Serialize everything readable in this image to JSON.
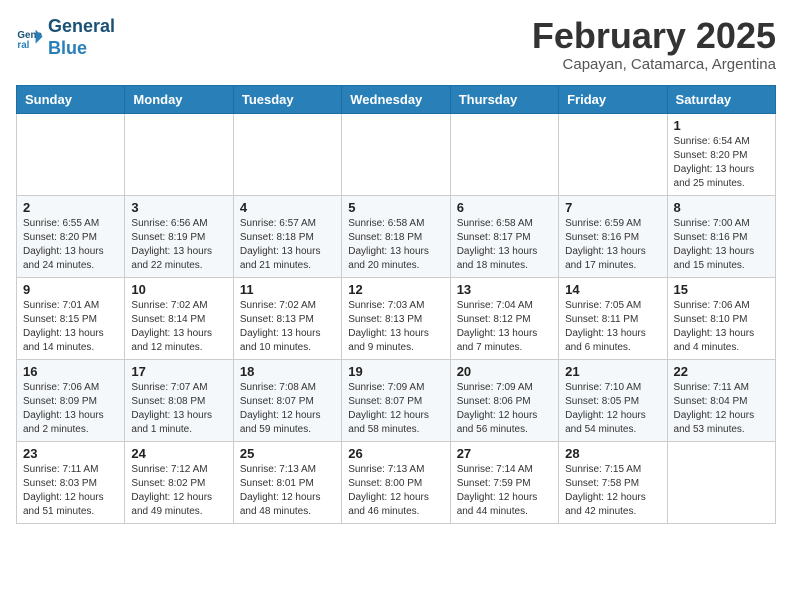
{
  "header": {
    "logo_line1": "General",
    "logo_line2": "Blue",
    "month": "February 2025",
    "location": "Capayan, Catamarca, Argentina"
  },
  "days_of_week": [
    "Sunday",
    "Monday",
    "Tuesday",
    "Wednesday",
    "Thursday",
    "Friday",
    "Saturday"
  ],
  "weeks": [
    [
      {
        "day": "",
        "info": ""
      },
      {
        "day": "",
        "info": ""
      },
      {
        "day": "",
        "info": ""
      },
      {
        "day": "",
        "info": ""
      },
      {
        "day": "",
        "info": ""
      },
      {
        "day": "",
        "info": ""
      },
      {
        "day": "1",
        "info": "Sunrise: 6:54 AM\nSunset: 8:20 PM\nDaylight: 13 hours\nand 25 minutes."
      }
    ],
    [
      {
        "day": "2",
        "info": "Sunrise: 6:55 AM\nSunset: 8:20 PM\nDaylight: 13 hours\nand 24 minutes."
      },
      {
        "day": "3",
        "info": "Sunrise: 6:56 AM\nSunset: 8:19 PM\nDaylight: 13 hours\nand 22 minutes."
      },
      {
        "day": "4",
        "info": "Sunrise: 6:57 AM\nSunset: 8:18 PM\nDaylight: 13 hours\nand 21 minutes."
      },
      {
        "day": "5",
        "info": "Sunrise: 6:58 AM\nSunset: 8:18 PM\nDaylight: 13 hours\nand 20 minutes."
      },
      {
        "day": "6",
        "info": "Sunrise: 6:58 AM\nSunset: 8:17 PM\nDaylight: 13 hours\nand 18 minutes."
      },
      {
        "day": "7",
        "info": "Sunrise: 6:59 AM\nSunset: 8:16 PM\nDaylight: 13 hours\nand 17 minutes."
      },
      {
        "day": "8",
        "info": "Sunrise: 7:00 AM\nSunset: 8:16 PM\nDaylight: 13 hours\nand 15 minutes."
      }
    ],
    [
      {
        "day": "9",
        "info": "Sunrise: 7:01 AM\nSunset: 8:15 PM\nDaylight: 13 hours\nand 14 minutes."
      },
      {
        "day": "10",
        "info": "Sunrise: 7:02 AM\nSunset: 8:14 PM\nDaylight: 13 hours\nand 12 minutes."
      },
      {
        "day": "11",
        "info": "Sunrise: 7:02 AM\nSunset: 8:13 PM\nDaylight: 13 hours\nand 10 minutes."
      },
      {
        "day": "12",
        "info": "Sunrise: 7:03 AM\nSunset: 8:13 PM\nDaylight: 13 hours\nand 9 minutes."
      },
      {
        "day": "13",
        "info": "Sunrise: 7:04 AM\nSunset: 8:12 PM\nDaylight: 13 hours\nand 7 minutes."
      },
      {
        "day": "14",
        "info": "Sunrise: 7:05 AM\nSunset: 8:11 PM\nDaylight: 13 hours\nand 6 minutes."
      },
      {
        "day": "15",
        "info": "Sunrise: 7:06 AM\nSunset: 8:10 PM\nDaylight: 13 hours\nand 4 minutes."
      }
    ],
    [
      {
        "day": "16",
        "info": "Sunrise: 7:06 AM\nSunset: 8:09 PM\nDaylight: 13 hours\nand 2 minutes."
      },
      {
        "day": "17",
        "info": "Sunrise: 7:07 AM\nSunset: 8:08 PM\nDaylight: 13 hours\nand 1 minute."
      },
      {
        "day": "18",
        "info": "Sunrise: 7:08 AM\nSunset: 8:07 PM\nDaylight: 12 hours\nand 59 minutes."
      },
      {
        "day": "19",
        "info": "Sunrise: 7:09 AM\nSunset: 8:07 PM\nDaylight: 12 hours\nand 58 minutes."
      },
      {
        "day": "20",
        "info": "Sunrise: 7:09 AM\nSunset: 8:06 PM\nDaylight: 12 hours\nand 56 minutes."
      },
      {
        "day": "21",
        "info": "Sunrise: 7:10 AM\nSunset: 8:05 PM\nDaylight: 12 hours\nand 54 minutes."
      },
      {
        "day": "22",
        "info": "Sunrise: 7:11 AM\nSunset: 8:04 PM\nDaylight: 12 hours\nand 53 minutes."
      }
    ],
    [
      {
        "day": "23",
        "info": "Sunrise: 7:11 AM\nSunset: 8:03 PM\nDaylight: 12 hours\nand 51 minutes."
      },
      {
        "day": "24",
        "info": "Sunrise: 7:12 AM\nSunset: 8:02 PM\nDaylight: 12 hours\nand 49 minutes."
      },
      {
        "day": "25",
        "info": "Sunrise: 7:13 AM\nSunset: 8:01 PM\nDaylight: 12 hours\nand 48 minutes."
      },
      {
        "day": "26",
        "info": "Sunrise: 7:13 AM\nSunset: 8:00 PM\nDaylight: 12 hours\nand 46 minutes."
      },
      {
        "day": "27",
        "info": "Sunrise: 7:14 AM\nSunset: 7:59 PM\nDaylight: 12 hours\nand 44 minutes."
      },
      {
        "day": "28",
        "info": "Sunrise: 7:15 AM\nSunset: 7:58 PM\nDaylight: 12 hours\nand 42 minutes."
      },
      {
        "day": "",
        "info": ""
      }
    ]
  ]
}
